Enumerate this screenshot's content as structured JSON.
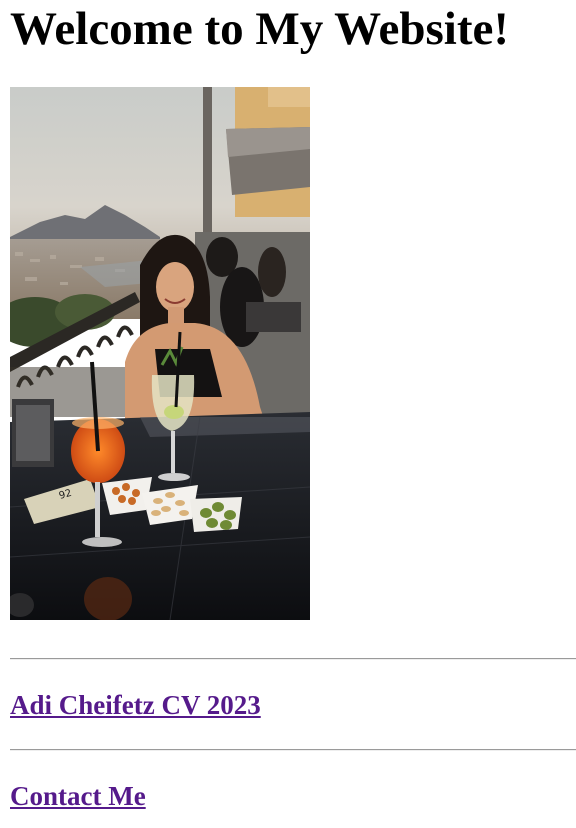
{
  "header": {
    "title": "Welcome to My Website!"
  },
  "photo": {
    "alt": "Photo of a woman at an outdoor terrace table with drinks and snacks, overlooking a city bay and a mountain"
  },
  "links": {
    "cv_label": "Adi Cheifetz CV 2023",
    "contact_label": "Contact Me"
  },
  "colors": {
    "link_visited": "#551a8b",
    "rule": "#9a9a9a",
    "background": "#ffffff"
  }
}
